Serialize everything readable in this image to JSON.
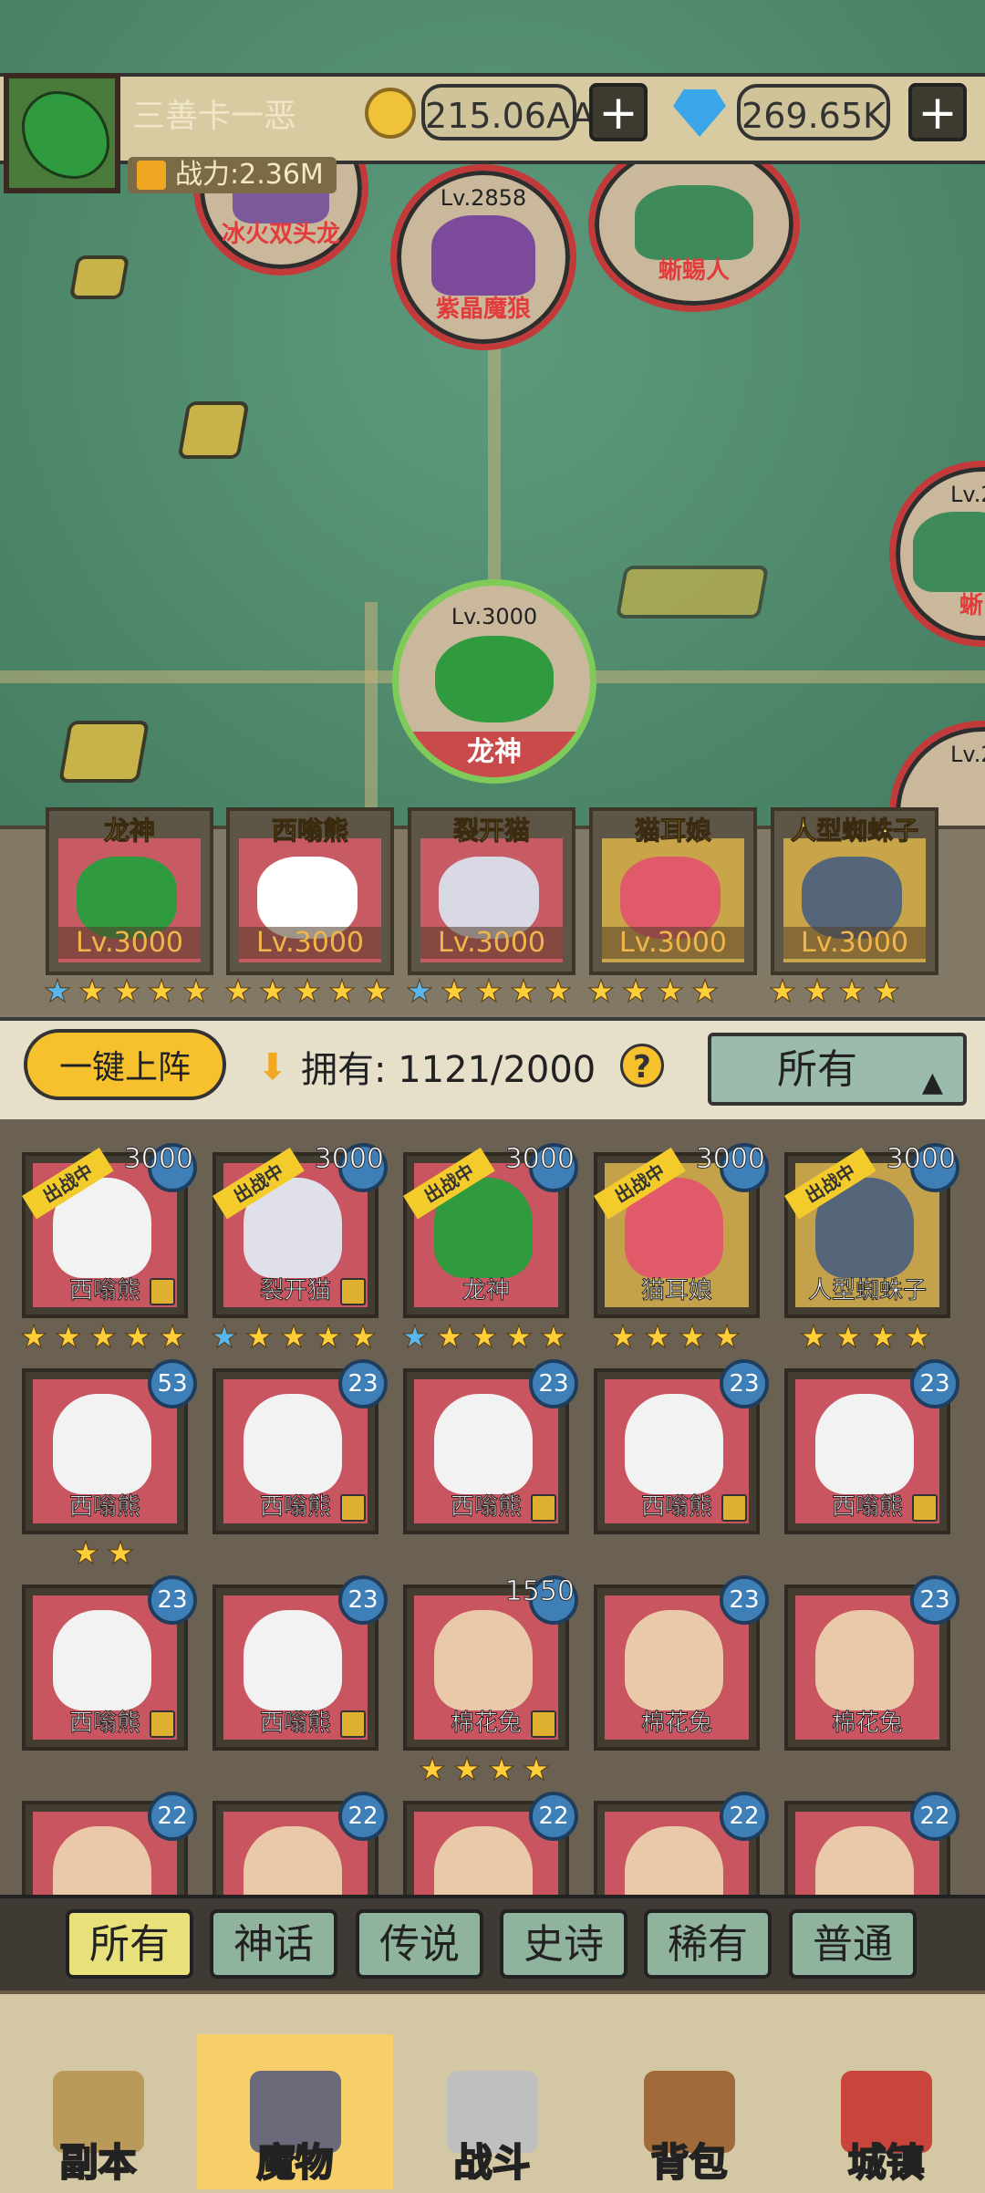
{
  "header": {
    "player_name": "三善卡一恶",
    "power_label": "战力:2.36M",
    "gold": "215.06AA",
    "gems": "269.65K",
    "plus": "+"
  },
  "map": {
    "enemies": [
      {
        "name": "冰火双头龙",
        "level": ""
      },
      {
        "name": "紫晶魔狼",
        "level": "Lv.2858"
      },
      {
        "name": "蜥蜴人",
        "level": ""
      },
      {
        "name": "蜥",
        "level": "Lv.2"
      },
      {
        "name": "",
        "level": "Lv.2"
      }
    ],
    "ally": {
      "name": "龙神",
      "level": "Lv.3000"
    }
  },
  "team": [
    {
      "name": "龙神",
      "level": "Lv.3000",
      "stars": 5,
      "blue_stars": 1
    },
    {
      "name": "西嗡熊",
      "level": "Lv.3000",
      "stars": 5,
      "blue_stars": 0
    },
    {
      "name": "裂开猫",
      "level": "Lv.3000",
      "stars": 5,
      "blue_stars": 1
    },
    {
      "name": "猫耳娘",
      "level": "Lv.3000",
      "stars": 4,
      "blue_stars": 0
    },
    {
      "name": "人型蜘蛛子",
      "level": "Lv.3000",
      "stars": 4,
      "blue_stars": 0
    }
  ],
  "controls": {
    "deploy_label": "一键上阵",
    "own_label": "拥有: 1121/2000",
    "help": "?",
    "filter_value": "所有"
  },
  "grid": {
    "ribbon_label": "出战中",
    "cards": [
      {
        "name": "西嗡熊",
        "badge": "3000",
        "deployed": true,
        "stars": 5,
        "blue": 0,
        "lock": true,
        "color": "red"
      },
      {
        "name": "裂开猫",
        "badge": "3000",
        "deployed": true,
        "stars": 5,
        "blue": 1,
        "lock": true,
        "color": "red"
      },
      {
        "name": "龙神",
        "badge": "3000",
        "deployed": true,
        "stars": 5,
        "blue": 1,
        "lock": false,
        "color": "red"
      },
      {
        "name": "猫耳娘",
        "badge": "3000",
        "deployed": true,
        "stars": 4,
        "blue": 0,
        "lock": false,
        "color": "gold"
      },
      {
        "name": "人型蜘蛛子",
        "badge": "3000",
        "deployed": true,
        "stars": 4,
        "blue": 0,
        "lock": false,
        "color": "gold"
      },
      {
        "name": "西嗡熊",
        "badge": "53",
        "deployed": false,
        "stars": 2,
        "blue": 0,
        "lock": false,
        "color": "red"
      },
      {
        "name": "西嗡熊",
        "badge": "23",
        "deployed": false,
        "stars": 0,
        "blue": 0,
        "lock": true,
        "color": "red"
      },
      {
        "name": "西嗡熊",
        "badge": "23",
        "deployed": false,
        "stars": 0,
        "blue": 0,
        "lock": true,
        "color": "red"
      },
      {
        "name": "西嗡熊",
        "badge": "23",
        "deployed": false,
        "stars": 0,
        "blue": 0,
        "lock": true,
        "color": "red"
      },
      {
        "name": "西嗡熊",
        "badge": "23",
        "deployed": false,
        "stars": 0,
        "blue": 0,
        "lock": true,
        "color": "red"
      },
      {
        "name": "西嗡熊",
        "badge": "23",
        "deployed": false,
        "stars": 0,
        "blue": 0,
        "lock": true,
        "color": "red"
      },
      {
        "name": "西嗡熊",
        "badge": "23",
        "deployed": false,
        "stars": 0,
        "blue": 0,
        "lock": true,
        "color": "red"
      },
      {
        "name": "棉花兔",
        "badge": "1550",
        "deployed": false,
        "stars": 4,
        "blue": 0,
        "lock": true,
        "color": "red"
      },
      {
        "name": "棉花兔",
        "badge": "23",
        "deployed": false,
        "stars": 0,
        "blue": 0,
        "lock": false,
        "color": "red"
      },
      {
        "name": "棉花兔",
        "badge": "23",
        "deployed": false,
        "stars": 0,
        "blue": 0,
        "lock": false,
        "color": "red"
      },
      {
        "name": "",
        "badge": "22",
        "deployed": false,
        "stars": 0,
        "blue": 0,
        "lock": false,
        "color": "red"
      },
      {
        "name": "",
        "badge": "22",
        "deployed": false,
        "stars": 0,
        "blue": 0,
        "lock": false,
        "color": "red"
      },
      {
        "name": "",
        "badge": "22",
        "deployed": false,
        "stars": 0,
        "blue": 0,
        "lock": false,
        "color": "red"
      },
      {
        "name": "",
        "badge": "22",
        "deployed": false,
        "stars": 0,
        "blue": 0,
        "lock": false,
        "color": "red"
      },
      {
        "name": "",
        "badge": "22",
        "deployed": false,
        "stars": 0,
        "blue": 0,
        "lock": false,
        "color": "red"
      }
    ]
  },
  "rarity_tabs": [
    "所有",
    "神话",
    "传说",
    "史诗",
    "稀有",
    "普通"
  ],
  "nav": [
    "副本",
    "魔物",
    "战斗",
    "背包",
    "城镇"
  ],
  "colors": {
    "accent": "#f6c12d",
    "enemy_ring": "#c43a3a",
    "ally_ring": "#7ecb5a",
    "badge": "#3e7fb8"
  }
}
